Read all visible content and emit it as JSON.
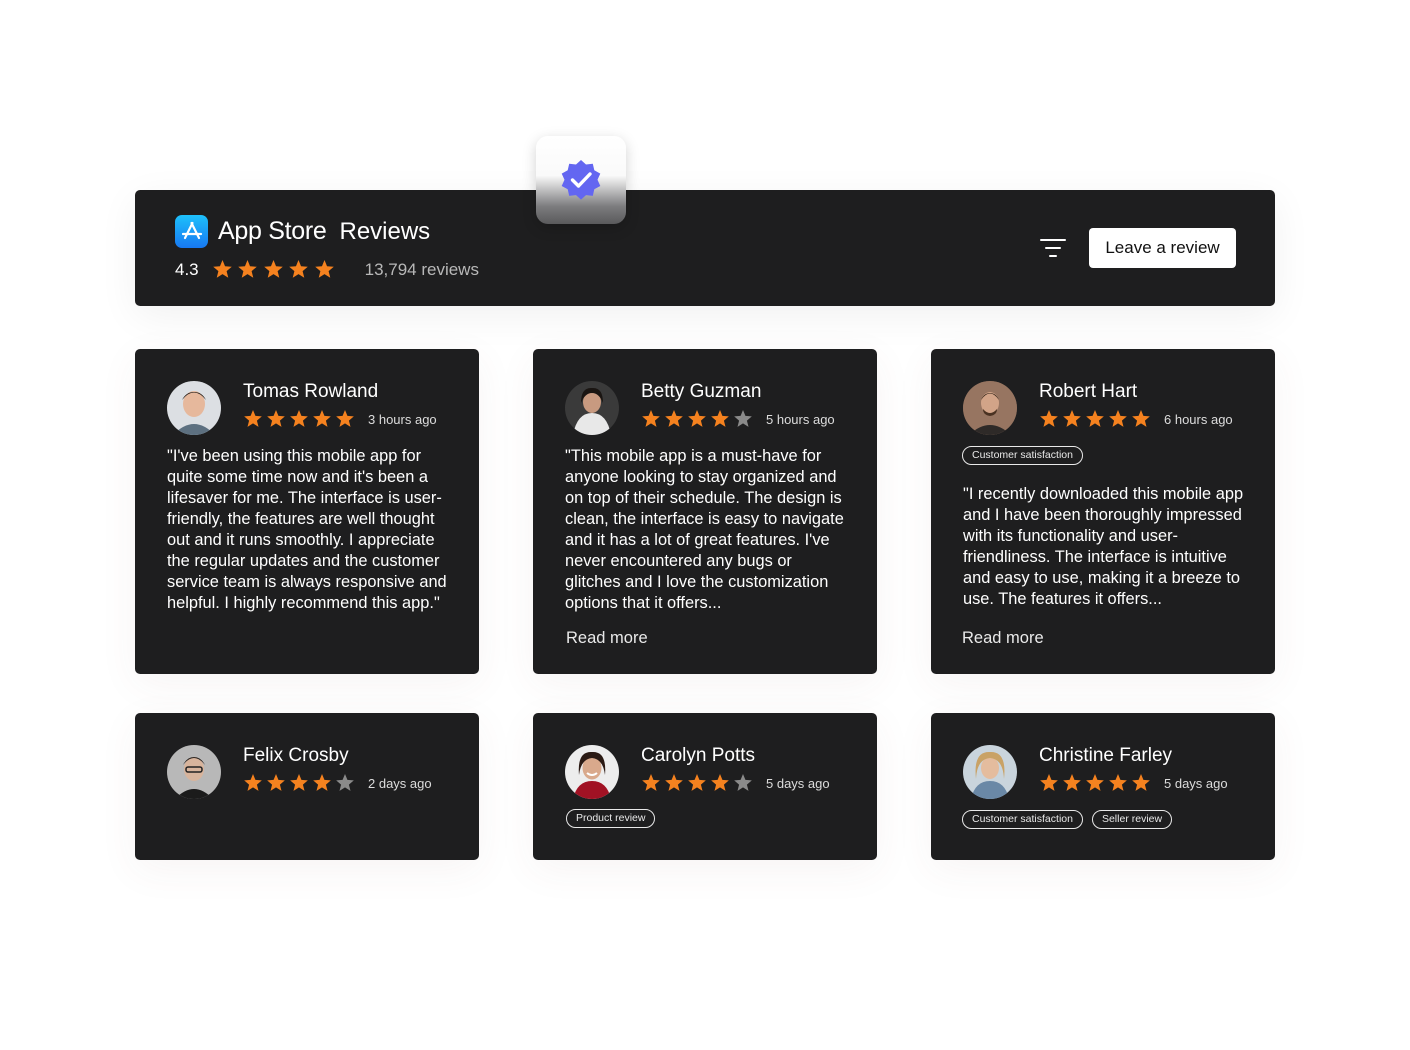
{
  "header": {
    "brand_name": "App Store",
    "brand_sub": "Reviews",
    "rating": "4.3",
    "rating_stars": 5,
    "review_count": "13,794 reviews",
    "leave_review_label": "Leave a review",
    "filter_icon": "filter-icon"
  },
  "colors": {
    "card_bg": "#1e1e1f",
    "star_filled": "#f5821f",
    "star_empty": "#8a8a8a",
    "badge_accent": "#6366f1"
  },
  "reviews": [
    {
      "name": "Tomas Rowland",
      "stars": 5,
      "time": "3 hours ago",
      "tags": [],
      "text": "\"I've been using this mobile app for quite some time now and it's been a lifesaver for me. The interface is user-friendly, the features are well thought out and it runs smoothly. I appreciate the regular updates and the customer service team is always responsive and helpful. I highly recommend this app.\""
    },
    {
      "name": "Betty Guzman",
      "stars": 4,
      "time": "5 hours ago",
      "tags": [],
      "text": "\"This mobile app is a must-have for anyone looking to stay organized and on top of their schedule. The design is clean, the interface is easy to navigate and it has a lot of great features. I've never encountered any bugs or glitches and I love the customization options that it offers...",
      "read_more": "Read more"
    },
    {
      "name": "Robert Hart",
      "stars": 5,
      "time": "6 hours ago",
      "tags": [
        "Customer satisfaction"
      ],
      "text": "\"I recently downloaded this mobile app and I have been thoroughly impressed with its functionality and user-friendliness. The interface is intuitive and easy to use, making it a breeze to use. The features it offers...",
      "read_more": "Read more"
    },
    {
      "name": "Felix Crosby",
      "stars": 4,
      "time": "2 days ago",
      "tags": []
    },
    {
      "name": "Carolyn Potts",
      "stars": 4,
      "time": "5 days ago",
      "tags": [
        "Product review"
      ]
    },
    {
      "name": "Christine Farley",
      "stars": 5,
      "time": "5 days ago",
      "tags": [
        "Customer satisfaction",
        "Seller review"
      ]
    }
  ]
}
